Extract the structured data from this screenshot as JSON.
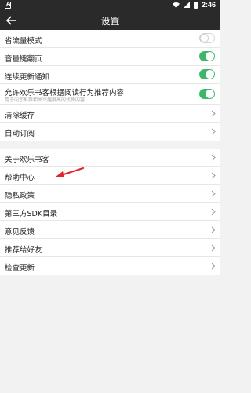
{
  "status_bar": {
    "time": "2:46"
  },
  "app_bar": {
    "title": "设置"
  },
  "colors": {
    "accent": "#3db86b",
    "bar": "#2a2a2a"
  },
  "group1": [
    {
      "label": "省流量模式",
      "control": "toggle",
      "on": false
    },
    {
      "label": "音量键翻页",
      "control": "toggle",
      "on": true
    },
    {
      "label": "连续更新通知",
      "control": "toggle",
      "on": true
    },
    {
      "label": "允许欢乐书客根据阅读行为推荐内容",
      "sublabel": "用于向您推荐相关兴趣度高的优质内容",
      "control": "toggle",
      "on": true
    },
    {
      "label": "清除缓存",
      "control": "chevron"
    },
    {
      "label": "自动订阅",
      "control": "chevron"
    }
  ],
  "group2": [
    {
      "label": "关于欢乐书客",
      "control": "chevron"
    },
    {
      "label": "帮助中心",
      "control": "chevron"
    },
    {
      "label": "隐私政策",
      "control": "chevron"
    },
    {
      "label": "第三方SDK目录",
      "control": "chevron"
    },
    {
      "label": "意见反馈",
      "control": "chevron"
    },
    {
      "label": "推荐给好友",
      "control": "chevron"
    },
    {
      "label": "检查更新",
      "control": "chevron"
    }
  ]
}
